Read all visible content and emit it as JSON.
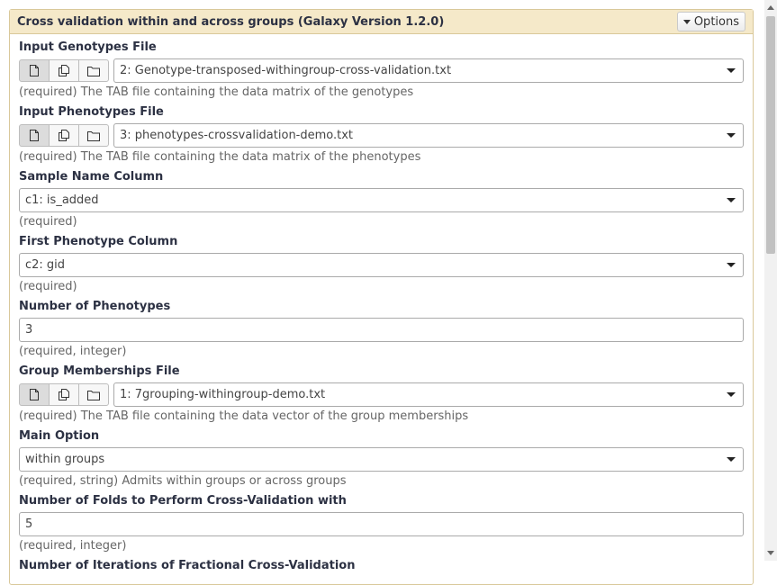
{
  "tool": {
    "title": "Cross validation within and across groups (Galaxy Version 1.2.0)",
    "options_label": "Options"
  },
  "fields": {
    "genotypes": {
      "label": "Input Genotypes File",
      "value": "2: Genotype-transposed-withingroup-cross-validation.txt",
      "help": "(required) The TAB file containing the data matrix of the genotypes"
    },
    "phenotypes": {
      "label": "Input Phenotypes File",
      "value": "3: phenotypes-crossvalidation-demo.txt",
      "help": "(required) The TAB file containing the data matrix of the phenotypes"
    },
    "sample_col": {
      "label": "Sample Name Column",
      "value": "c1: is_added",
      "help": "(required)"
    },
    "first_pheno": {
      "label": "First Phenotype Column",
      "value": "c2: gid",
      "help": "(required)"
    },
    "num_pheno": {
      "label": "Number of Phenotypes",
      "value": "3",
      "help": "(required, integer)"
    },
    "groups": {
      "label": "Group Memberships File",
      "value": "1: 7grouping-withingroup-demo.txt",
      "help": "(required) The TAB file containing the data vector of the group memberships"
    },
    "main_option": {
      "label": "Main Option",
      "value": "within groups",
      "help": "(required, string) Admits within groups or across groups"
    },
    "folds": {
      "label": "Number of Folds to Perform Cross-Validation with",
      "value": "5",
      "help": "(required, integer)"
    },
    "iterations": {
      "label": "Number of Iterations of Fractional Cross-Validation"
    }
  },
  "icons": {
    "single": "single-dataset-icon",
    "multiple": "multiple-datasets-icon",
    "collection": "dataset-collection-icon"
  }
}
